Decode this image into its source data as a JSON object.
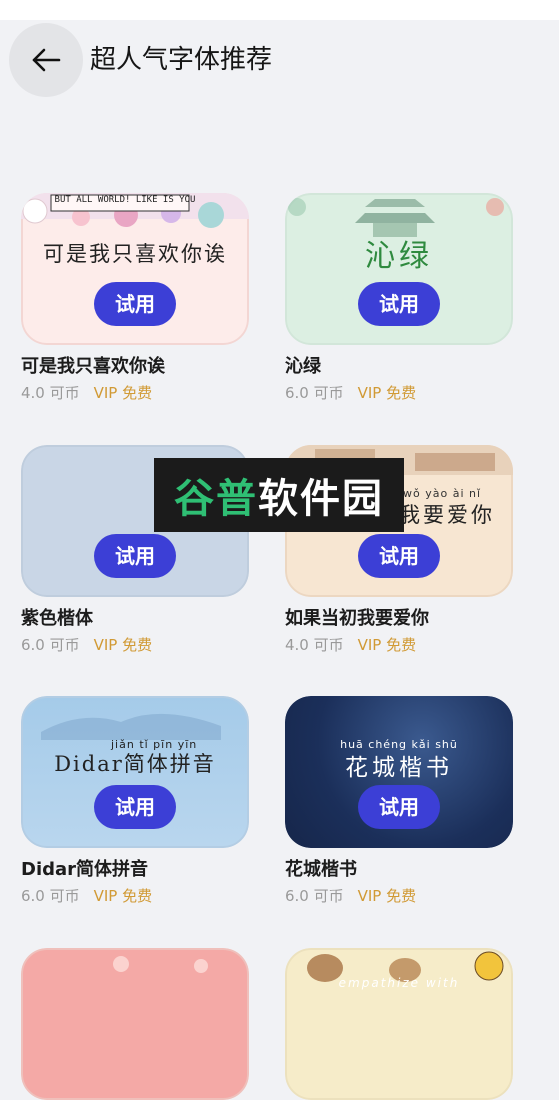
{
  "header": {
    "title": "超人气字体推荐",
    "back_icon": "arrow-left-icon"
  },
  "try_label": "试用",
  "fonts": [
    {
      "name": "可是我只喜欢你诶",
      "price": "4.0 可币",
      "vip": "VIP 免费",
      "preview": "可是我只喜欢你诶",
      "banner": "BUT ALL WORLD! LIKE IS YOU"
    },
    {
      "name": "沁绿",
      "price": "6.0 可币",
      "vip": "VIP 免费",
      "preview": "沁绿"
    },
    {
      "name": "紫色楷体",
      "price": "6.0 可币",
      "vip": "VIP 免费"
    },
    {
      "name": "如果当初我要爱你",
      "price": "4.0 可币",
      "vip": "VIP 免费",
      "preview": "我要爱你",
      "pinyin": "wǒ yào ài nǐ"
    },
    {
      "name": "Didar简体拼音",
      "price": "6.0 可币",
      "vip": "VIP 免费",
      "preview": "Didar简体拼音",
      "pinyin": "jiǎn tǐ pīn yīn"
    },
    {
      "name": "花城楷书",
      "price": "6.0 可币",
      "vip": "VIP 免费",
      "preview": "花城楷书",
      "pinyin": "huā chéng kǎi shū"
    },
    {
      "preview_caption": "empathize with"
    }
  ],
  "watermark": {
    "green": "谷普",
    "white": "软件园"
  },
  "colors": {
    "accent": "#3c3fd6",
    "vip": "#d19a35",
    "background": "#f1f2f5"
  }
}
